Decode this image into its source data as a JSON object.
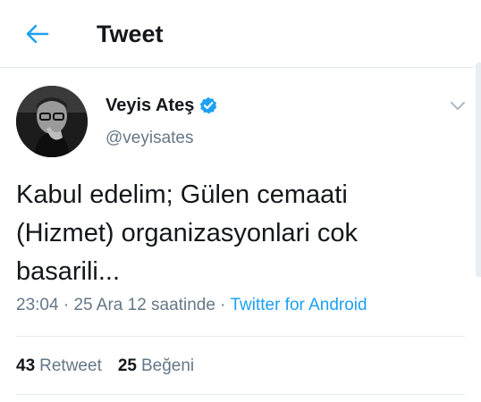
{
  "header": {
    "title": "Tweet",
    "back_icon": "arrow-left-icon",
    "accent_color": "#1da1f2"
  },
  "tweet": {
    "author": {
      "display_name": "Veyis Ateş",
      "handle": "@veyisates",
      "verified_icon": "verified-badge-icon"
    },
    "text": "Kabul edelim; Gülen cemaati\n(Hizmet) organizasyonlari cok\nbasarili...",
    "time": "23:04",
    "separator": " · ",
    "date": "25 Ara 12 saatinde",
    "source": "Twitter for Android",
    "menu_icon": "chevron-down-icon"
  },
  "stats": {
    "retweets_count": "43",
    "retweets_label": "Retweet",
    "likes_count": "25",
    "likes_label": "Beğeni"
  }
}
